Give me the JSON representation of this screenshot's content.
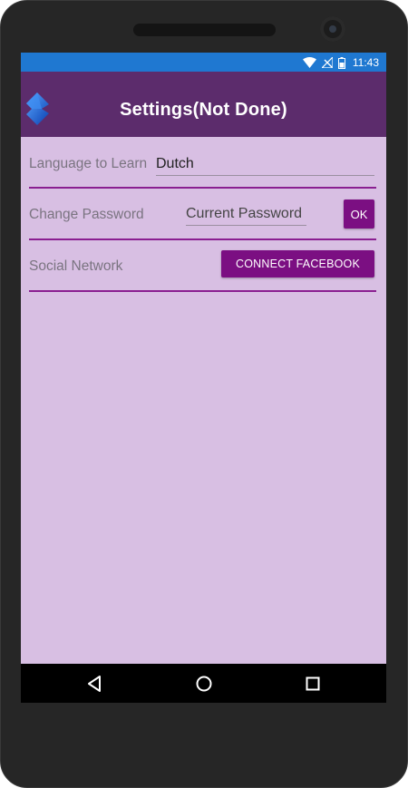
{
  "statusbar": {
    "time": "11:43",
    "icons": [
      "wifi-icon",
      "no-signal-icon",
      "battery-icon"
    ]
  },
  "appbar": {
    "title": "Settings(Not Done)",
    "back_icon": "back-arrow-icon"
  },
  "settings": {
    "language": {
      "label": "Language to Learn",
      "value": "Dutch"
    },
    "password": {
      "label": "Change Password",
      "placeholder": "Current Password",
      "ok_label": "OK"
    },
    "social": {
      "label": "Social Network",
      "button_label": "CONNECT FACEBOOK"
    }
  },
  "navbar": {
    "buttons": [
      "back-icon",
      "home-icon",
      "recents-icon"
    ]
  },
  "colors": {
    "statusbar": "#1f78d1",
    "appbar": "#5c2c6c",
    "background": "#d8bfe3",
    "accent": "#7b0f82",
    "divider": "#8a1f91"
  }
}
